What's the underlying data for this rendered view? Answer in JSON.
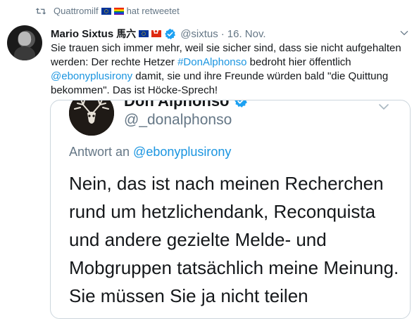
{
  "retweet": {
    "icon": "retweet-icon",
    "user": "Quattromilf",
    "flags": [
      "eu-flag",
      "rainbow-flag"
    ],
    "label": "hat retweetet"
  },
  "tweet": {
    "author_name": "Mario Sixtus",
    "author_hanzi": "馬六",
    "author_flags": [
      "eu-flag",
      "hong-kong-flag"
    ],
    "handle": "@sixtus",
    "separator": "·",
    "date": "16. Nov.",
    "text_parts": {
      "p1": "Sie trauen sich immer mehr, weil sie sicher sind, dass sie nicht aufgehalten werden: Der rechte Hetzer ",
      "hashtag": "#DonAlphonso",
      "p2": " bedroht hier öffentlich ",
      "mention": "@ebonyplusirony",
      "p3": " damit, sie und ihre Freunde würden bald \"die Quittung bekommen\". Das ist Höcke-Sprech!"
    }
  },
  "embedded": {
    "name": "Don Alphonso",
    "handle": "@_donalphonso",
    "reply_prefix": "Antwort an ",
    "reply_to": "@ebonyplusirony",
    "body": "Nein, das ist nach meinen Recherchen rund um hetzlichendank, Reconquista und andere gezielte Melde- und Mobgruppen tatsächlich meine Meinung. Sie müssen Sie ja nicht teilen"
  },
  "colors": {
    "link": "#1b95e0",
    "secondary": "#657786",
    "verified": "#1da1f2"
  }
}
